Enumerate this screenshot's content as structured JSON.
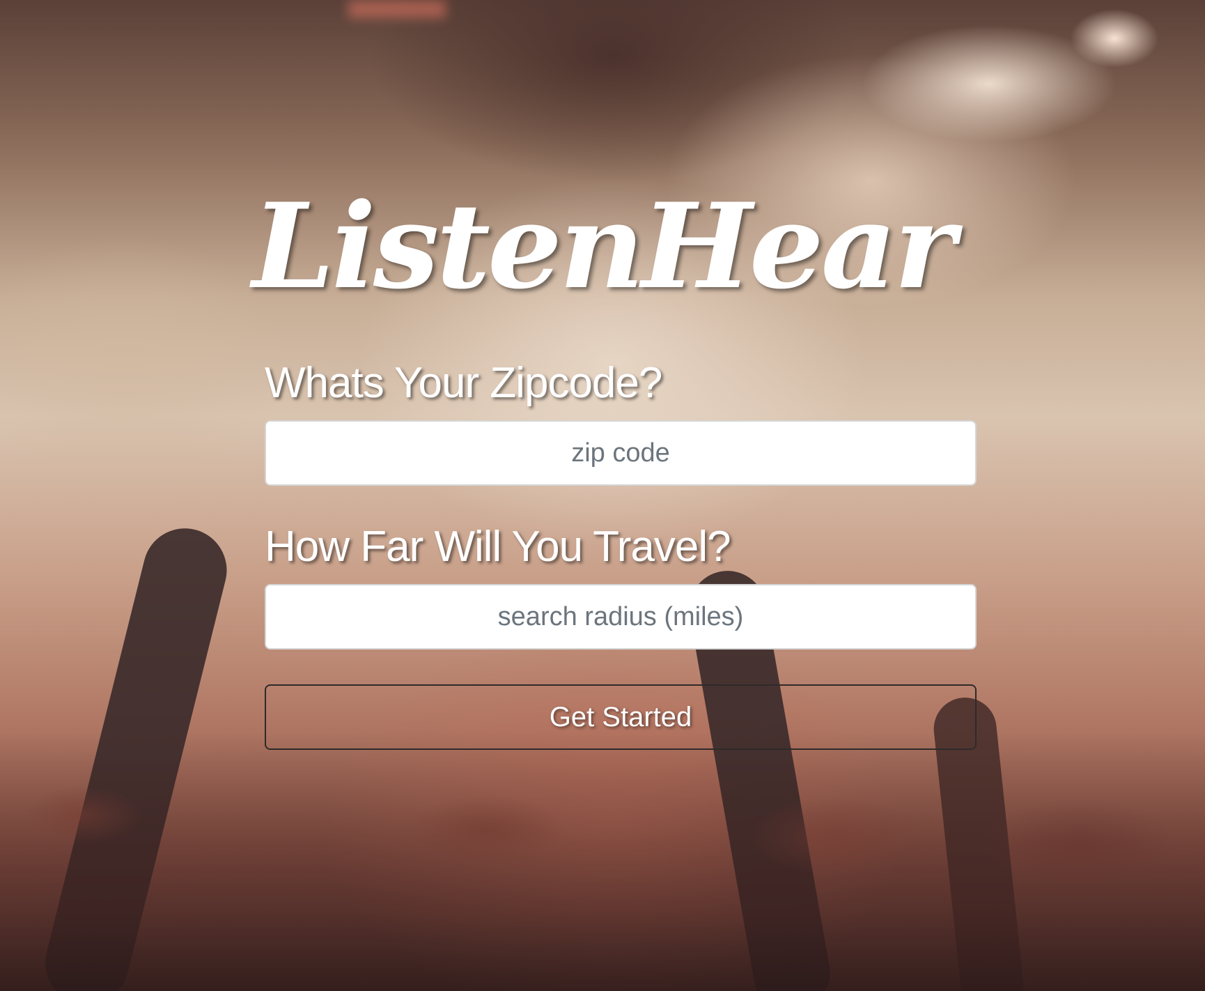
{
  "logo": {
    "text": "ListenHear"
  },
  "form": {
    "zip_label": "Whats Your Zipcode?",
    "zip_placeholder": "zip code",
    "radius_label": "How Far Will You Travel?",
    "radius_placeholder": "search radius (miles)",
    "submit_label": "Get Started"
  },
  "colors": {
    "text": "#ffffff",
    "field_background": "#ffffff",
    "placeholder": "#6c757d",
    "button_border": "#2e2a2a"
  }
}
